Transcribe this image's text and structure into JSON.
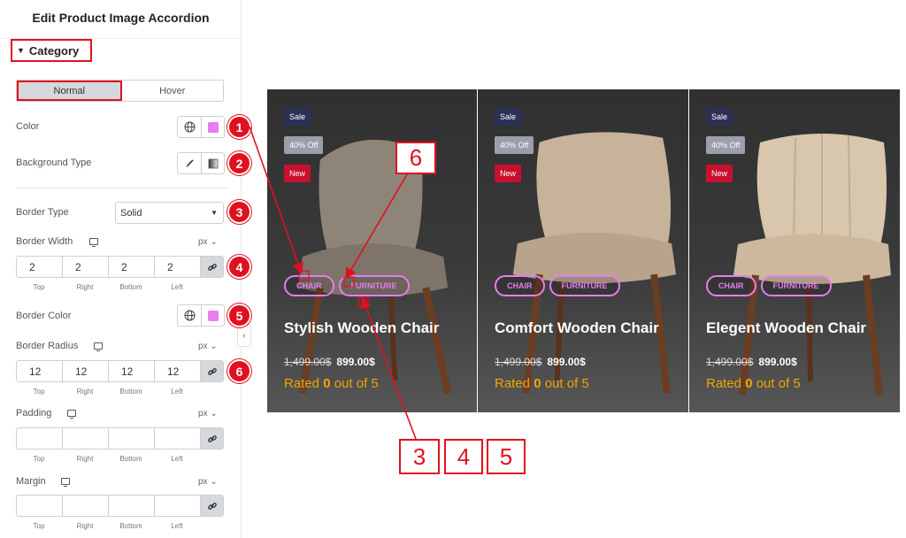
{
  "panel": {
    "title": "Edit Product Image Accordion",
    "section_label": "Category",
    "tabs": [
      {
        "label": "Normal",
        "active": true
      },
      {
        "label": "Hover",
        "active": false
      }
    ],
    "color_label": "Color",
    "bg_type_label": "Background Type",
    "border_type_label": "Border Type",
    "border_type_value": "Solid",
    "border_width_label": "Border Width",
    "border_width": {
      "top": "2",
      "right": "2",
      "bottom": "2",
      "left": "2"
    },
    "border_color_label": "Border Color",
    "border_radius_label": "Border Radius",
    "border_radius": {
      "top": "12",
      "right": "12",
      "bottom": "12",
      "left": "12"
    },
    "padding_label": "Padding",
    "margin_label": "Margin",
    "unit": "px",
    "dim_labels": {
      "top": "Top",
      "right": "Right",
      "bottom": "Bottom",
      "left": "Left"
    },
    "swatch_color": "#e77dee",
    "badges": [
      "1",
      "2",
      "3",
      "4",
      "5",
      "6"
    ]
  },
  "products": [
    {
      "sale": "Sale",
      "off": "40% Off",
      "new": "New",
      "tags": [
        "CHAIR",
        "FURNITURE"
      ],
      "title": "Stylish Wooden Chair",
      "old_price": "1,499.00$",
      "price": "899.00$",
      "rating_pre": "Rated ",
      "rating_val": "0",
      "rating_post": " out of 5"
    },
    {
      "sale": "Sale",
      "off": "40% Off",
      "new": "New",
      "tags": [
        "CHAIR",
        "FURNITURE"
      ],
      "title": "Comfort Wooden Chair",
      "old_price": "1,499.00$",
      "price": "899.00$",
      "rating_pre": "Rated ",
      "rating_val": "0",
      "rating_post": " out of 5"
    },
    {
      "sale": "Sale",
      "off": "40% Off",
      "new": "New",
      "tags": [
        "CHAIR",
        "FURNITURE"
      ],
      "title": "Elegent Wooden Chair",
      "old_price": "1,499.00$",
      "price": "899.00$",
      "rating_pre": "Rated ",
      "rating_val": "0",
      "rating_post": " out of 5"
    }
  ],
  "callouts": [
    "6",
    "3",
    "4",
    "5"
  ],
  "colors": {
    "accent": "#e0111f",
    "tag": "#e77dee",
    "rating": "#f0a500"
  }
}
